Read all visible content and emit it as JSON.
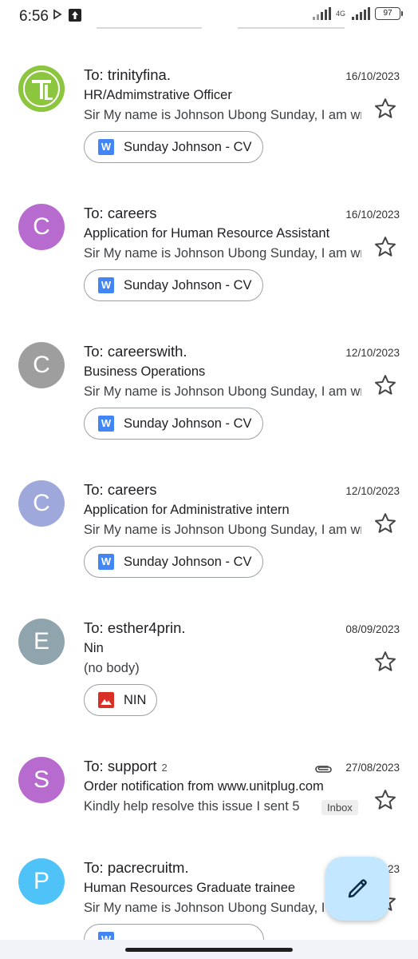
{
  "status_bar": {
    "time": "6:56",
    "network": "4G",
    "battery": "97"
  },
  "emails": [
    {
      "to": "To: trinityfina.",
      "date": "16/10/2023",
      "subject": "HR/Admimstrative Officer",
      "snippet": "Sir My name is Johnson Ubong Sunday, I am writing",
      "avatar_letter": "",
      "avatar_color": "#8cc63f",
      "attachment": "Sunday Johnson - CV",
      "attachment_type": "doc"
    },
    {
      "to": "To: careers",
      "date": "16/10/2023",
      "subject": "Application for Human Resource Assistant",
      "snippet": "Sir My name is Johnson Ubong Sunday, I am writing",
      "avatar_letter": "C",
      "avatar_color": "#b86bcf",
      "attachment": "Sunday Johnson - CV",
      "attachment_type": "doc"
    },
    {
      "to": "To: careerswith.",
      "date": "12/10/2023",
      "subject": "Business Operations",
      "snippet": "Sir My name is Johnson Ubong Sunday, I am writing",
      "avatar_letter": "C",
      "avatar_color": "#9e9e9e",
      "attachment": "Sunday Johnson - CV",
      "attachment_type": "doc"
    },
    {
      "to": "To: careers",
      "date": "12/10/2023",
      "subject": "Application for Administrative intern",
      "snippet": "Sir My name is Johnson Ubong Sunday, I am writing",
      "avatar_letter": "C",
      "avatar_color": "#9fa8da",
      "attachment": "Sunday Johnson - CV",
      "attachment_type": "doc"
    },
    {
      "to": "To: esther4prin.",
      "date": "08/09/2023",
      "subject": "Nin",
      "snippet": "(no body)",
      "avatar_letter": "E",
      "avatar_color": "#90a4ae",
      "attachment": "NIN",
      "attachment_type": "image"
    },
    {
      "to": "To: support",
      "thread_count": "2",
      "date": "27/08/2023",
      "subject": "Order notification from www.unitplug.com",
      "snippet": "Kindly help resolve this issue I sent 5",
      "label": "Inbox",
      "avatar_letter": "S",
      "avatar_color": "#b86bcf"
    },
    {
      "to": "To: pacrecruitm.",
      "date": "23",
      "subject": "Human Resources Graduate trainee",
      "snippet": "Sir My name is Johnson Ubong Sunday, I am writing",
      "avatar_letter": "P",
      "avatar_color": "#4fc3f7"
    }
  ],
  "fab": {
    "icon": "pencil-icon"
  }
}
